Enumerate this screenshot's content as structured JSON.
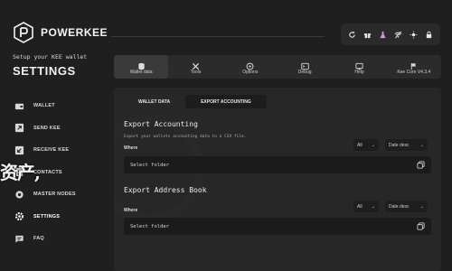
{
  "brand": {
    "name": "POWERKEE"
  },
  "sidebar": {
    "subtitle": "Setup your KEE wallet",
    "title": "SETTINGS",
    "items": [
      {
        "label": "WALLET",
        "icon": "wallet-icon"
      },
      {
        "label": "SEND KEE",
        "icon": "send-icon"
      },
      {
        "label": "RECEIVE KEE",
        "icon": "receive-icon"
      },
      {
        "label": "CONTACTS",
        "icon": "contacts-icon"
      },
      {
        "label": "MASTER NODES",
        "icon": "nodes-icon"
      },
      {
        "label": "SETTINGS",
        "icon": "gear-icon"
      },
      {
        "label": "FAQ",
        "icon": "chat-icon"
      }
    ]
  },
  "overlay_text": "资产,",
  "top_controls": [
    "refresh-icon",
    "gift-icon",
    "flask-icon",
    "broadcast-off-icon",
    "brightness-icon",
    "lock-icon"
  ],
  "tabs": [
    {
      "label": "Wallet data",
      "icon": "database-icon"
    },
    {
      "label": "Tools",
      "icon": "tools-icon"
    },
    {
      "label": "Options",
      "icon": "options-icon"
    },
    {
      "label": "Debug",
      "icon": "terminal-icon"
    },
    {
      "label": "Help",
      "icon": "help-icon"
    },
    {
      "label": "Kee Core V4.3.4",
      "icon": "flag-icon"
    }
  ],
  "subtabs": [
    "WALLET DATA",
    "EXPORT ACCOUNTING"
  ],
  "export_accounting": {
    "title": "Export Accounting",
    "description": "Export your wallets accounting data to a CSV file.",
    "where_label": "Where",
    "filter_value": "All",
    "sort_value": "Date desc",
    "folder_placeholder": "Select folder"
  },
  "export_address_book": {
    "title": "Export Address Book",
    "where_label": "Where",
    "filter_value": "All",
    "sort_value": "Date desc",
    "folder_placeholder": "Select folder"
  }
}
